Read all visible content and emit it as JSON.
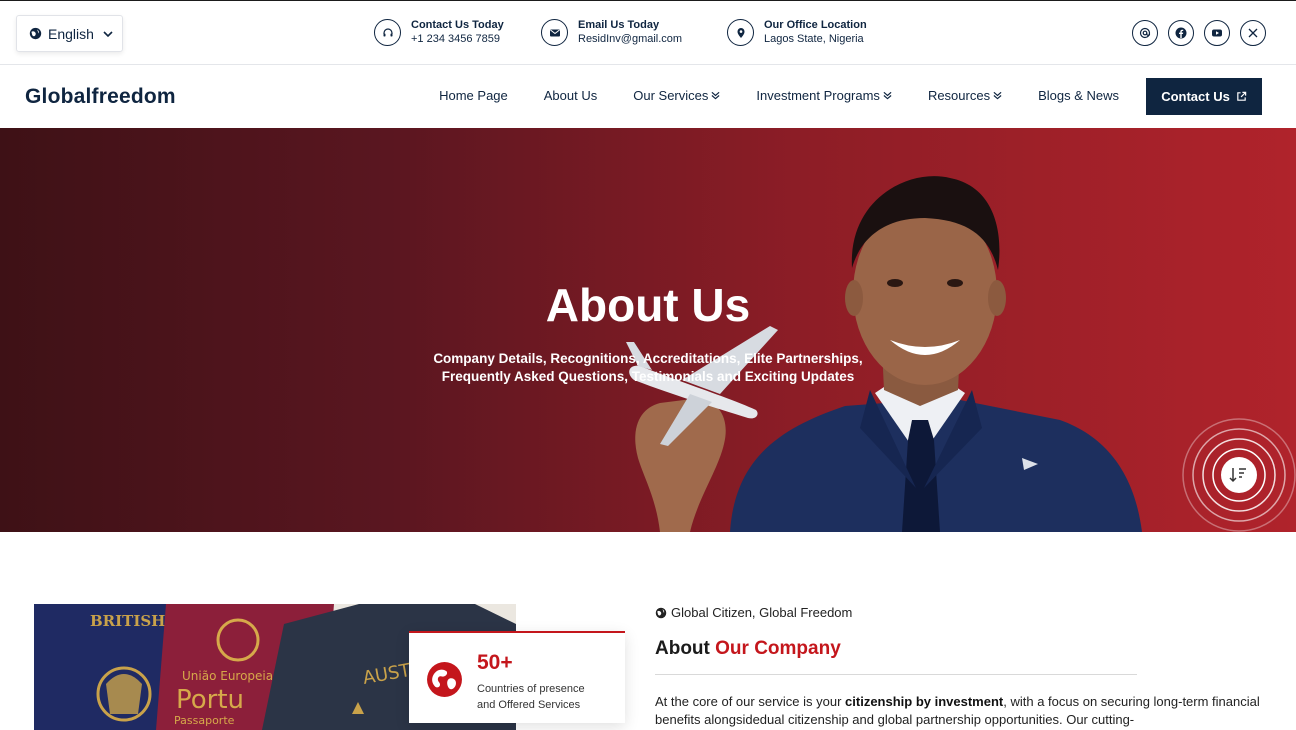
{
  "topbar": {
    "language": "English",
    "contacts": [
      {
        "title": "Contact Us Today",
        "value": "+1 234 3456 7859",
        "icon": "headset-icon"
      },
      {
        "title": "Email Us Today",
        "value": "ResidInv@gmail.com",
        "icon": "envelope-icon"
      },
      {
        "title": "Our Office Location",
        "value": "Lagos State, Nigeria",
        "icon": "map-pin-icon"
      }
    ],
    "socials": [
      "at-sign-icon",
      "facebook-icon",
      "youtube-icon",
      "x-twitter-icon"
    ]
  },
  "nav": {
    "logo": "Globalfreedom",
    "items": [
      {
        "label": "Home Page",
        "dropdown": false
      },
      {
        "label": "About Us",
        "dropdown": false
      },
      {
        "label": "Our Services",
        "dropdown": true
      },
      {
        "label": "Investment Programs",
        "dropdown": true
      },
      {
        "label": "Resources",
        "dropdown": true
      },
      {
        "label": "Blogs & News",
        "dropdown": false
      }
    ],
    "cta": "Contact Us"
  },
  "hero": {
    "title": "About Us",
    "subtitle_line1": "Company Details, Recognitions, Accreditations, Elite Partnerships,",
    "subtitle_line2": "Frequently Asked Questions, Testimonials and Exciting Updates"
  },
  "about": {
    "stat_number": "50+",
    "stat_desc_line1": "Countries of presence",
    "stat_desc_line2": "and Offered Services",
    "tagline": "Global Citizen, Global Freedom",
    "heading_part1": "About ",
    "heading_part2": "Our Company",
    "para_1": "At the core of our service is your ",
    "para_bold_1": "citizenship by investment",
    "para_2": ", with a focus on securing long-term financial benefits alongsidedual citizenship and global partnership opportunities. Our cutting-"
  },
  "colors": {
    "navy": "#0f2540",
    "brand_red": "#c4161c",
    "hero_gradient_start": "#3e1116",
    "hero_gradient_end": "#b0232b"
  }
}
